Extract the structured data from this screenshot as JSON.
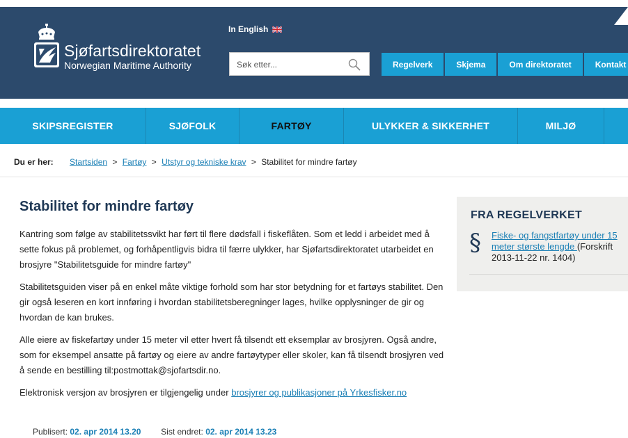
{
  "header": {
    "org_name": "Sjøfartsdirektoratet",
    "org_subname": "Norwegian Maritime Authority",
    "language_link": "In English",
    "search_placeholder": "Søk etter...",
    "top_links": [
      "Regelverk",
      "Skjema",
      "Om direktoratet",
      "Kontakt"
    ],
    "colors": {
      "header_bg": "#2c4a6c",
      "accent": "#1aa0d4"
    }
  },
  "nav": {
    "items": [
      "SKIPSREGISTER",
      "SJØFOLK",
      "FARTØY",
      "ULYKKER & SIKKERHET",
      "MILJØ"
    ],
    "active": "FARTØY"
  },
  "breadcrumb": {
    "label": "Du er her:",
    "links": [
      "Startsiden",
      "Fartøy",
      "Utstyr og tekniske krav"
    ],
    "separator": ">",
    "current": "Stabilitet for mindre fartøy"
  },
  "article": {
    "title": "Stabilitet for mindre fartøy",
    "paragraphs": [
      "Kantring som følge av stabilitetssvikt har ført til flere dødsfall i fiskeflåten. Som et ledd i arbeidet med å sette fokus på problemet, og forhåpentligvis bidra til færre ulykker, har Sjøfartsdirektoratet utarbeidet en brosjyre \"Stabilitetsguide for mindre fartøy\"",
      "Stabilitetsguiden viser på en enkel måte viktige forhold som har stor betydning for et fartøys stabilitet. Den gir også leseren en kort innføring i hvordan stabilitetsberegninger lages, hvilke opplysninger de gir og hvordan de kan brukes.",
      "Alle eiere av fiskefartøy under 15 meter vil etter hvert få tilsendt ett eksemplar av brosjyren. Også andre, som for eksempel ansatte på fartøy og eiere av andre fartøytyper eller skoler, kan få tilsendt brosjyren ved å sende en bestilling til:postmottak@sjofartsdir.no."
    ],
    "last_paragraph_text": "Elektronisk versjon av brosjyren er tilgjengelig under ",
    "last_paragraph_link": "brosjyrer og publikasjoner på Yrkesfisker.no"
  },
  "meta": {
    "published_label": "Publisert:",
    "published_value": "02. apr 2014 13.20",
    "changed_label": "Sist endret:",
    "changed_value": "02. apr 2014 13.23"
  },
  "sidebar": {
    "heading": "FRA REGELVERKET",
    "symbol": "§",
    "reg_link": "Fiske- og fangstfartøy under 15 meter største lengde ",
    "reg_suffix": "(Forskrift 2013-11-22 nr. 1404)"
  }
}
